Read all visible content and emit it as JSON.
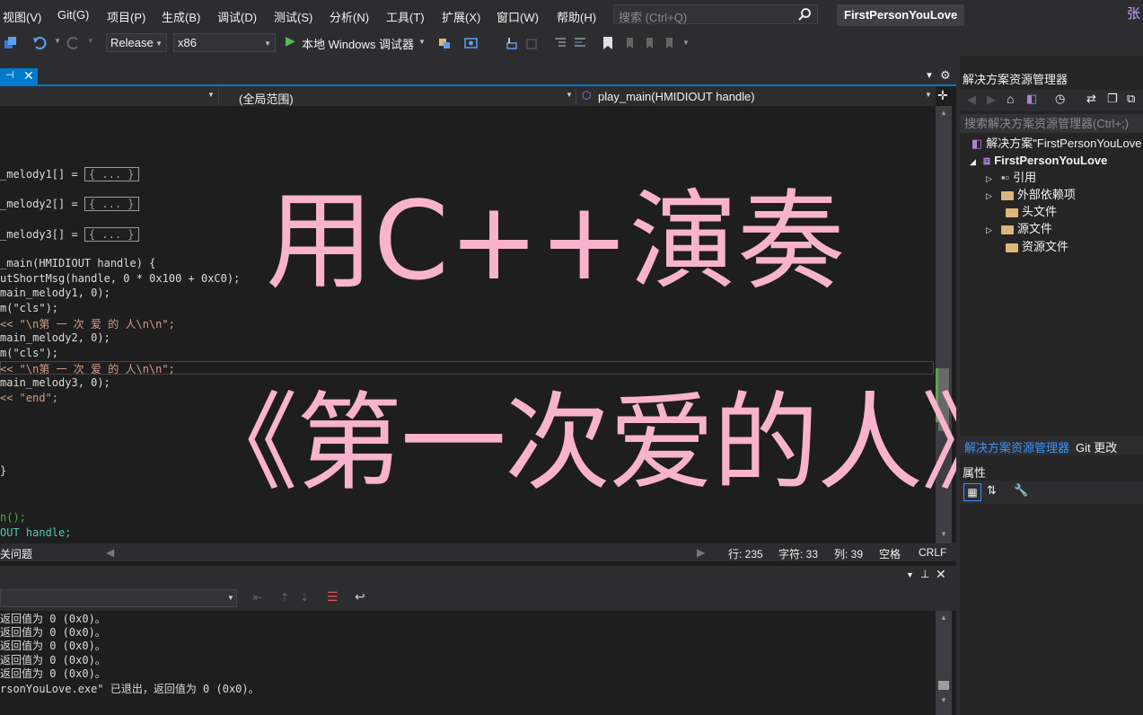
{
  "menu": [
    "视图(V)",
    "Git(G)",
    "项目(P)",
    "生成(B)",
    "调试(D)",
    "测试(S)",
    "分析(N)",
    "工具(T)",
    "扩展(X)",
    "窗口(W)",
    "帮助(H)"
  ],
  "search": {
    "placeholder": "搜索 (Ctrl+Q)"
  },
  "window_title": "FirstPersonYouLove",
  "user_initial": "张",
  "toolbar": {
    "config": "Release",
    "platform": "x86",
    "run_label": "本地 Windows 调试器"
  },
  "navbar": {
    "scope": "(全局范围)",
    "member": "play_main(HMIDIOUT handle)"
  },
  "code_lines": [
    "_melody1[] = ",
    "_melody2[] = ",
    "_melody3[] = ",
    "_main(HMIDIOUT handle) {",
    "utShortMsg(handle, 0 * 0x100 + 0xC0);",
    "main_melody1, 0);",
    "m(\"cls\");",
    "<< \"\\n第 一 次 爱 的 人\\n\\n\";",
    "main_melody2, 0);",
    "m(\"cls\");",
    "<< \"\\n第 一 次 爱 的 人\\n\\n\";",
    "main_melody3, 0);",
    "<< \"end\";",
    "}",
    "n();",
    "OUT handle;"
  ],
  "collapsed_label": "{ ... }",
  "overlay": {
    "line1": "用C++演奏",
    "line2": "《第一次爱的人》"
  },
  "status": {
    "issues": "关问题",
    "line": "行: 235",
    "char": "字符: 33",
    "col": "列: 39",
    "spaces": "空格",
    "eol": "CRLF"
  },
  "output_lines": [
    "返回值为 0 (0x0)。",
    "返回值为 0 (0x0)。",
    "返回值为 0 (0x0)。",
    "返回值为 0 (0x0)。",
    "返回值为 0 (0x0)。",
    "rsonYouLove.exe\" 已退出，返回值为 0 (0x0)。"
  ],
  "solution_explorer": {
    "title": "解决方案资源管理器",
    "search_placeholder": "搜索解决方案资源管理器(Ctrl+;)",
    "solution": "解决方案\"FirstPersonYouLove",
    "project": "FirstPersonYouLove",
    "items": [
      "引用",
      "外部依赖项",
      "头文件",
      "源文件",
      "资源文件"
    ]
  },
  "bottom_tabs": [
    "解决方案资源管理器",
    "Git 更改"
  ],
  "properties_title": "属性",
  "colors": {
    "accent": "#007acc",
    "overlay_text": "#f9b3cc",
    "background": "#1e1e1e"
  }
}
